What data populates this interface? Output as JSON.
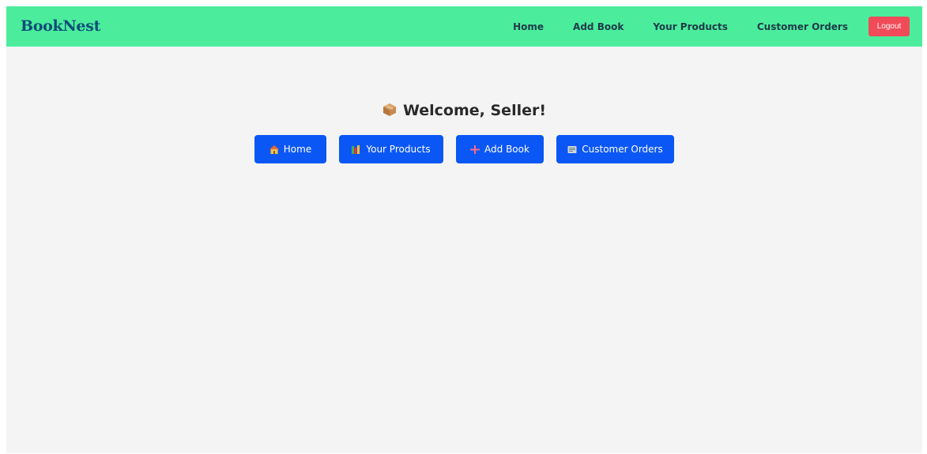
{
  "navbar": {
    "brand": "BookNest",
    "links": [
      "Home",
      "Add Book",
      "Your Products",
      "Customer Orders"
    ],
    "logout_label": "Logout",
    "colors": {
      "background": "#4bed9c",
      "brand": "#0e4d79",
      "logout": "#f14a58"
    }
  },
  "main": {
    "welcome": "Welcome, Seller!",
    "welcome_icon": "package-icon",
    "buttons": [
      {
        "label": "Home",
        "icon": "house-icon"
      },
      {
        "label": "Your Products",
        "icon": "books-icon"
      },
      {
        "label": "Add Book",
        "icon": "plus-icon"
      },
      {
        "label": "Customer Orders",
        "icon": "receipt-icon"
      }
    ],
    "colors": {
      "button": "#0b57f5",
      "background": "#f4f4f4"
    }
  }
}
